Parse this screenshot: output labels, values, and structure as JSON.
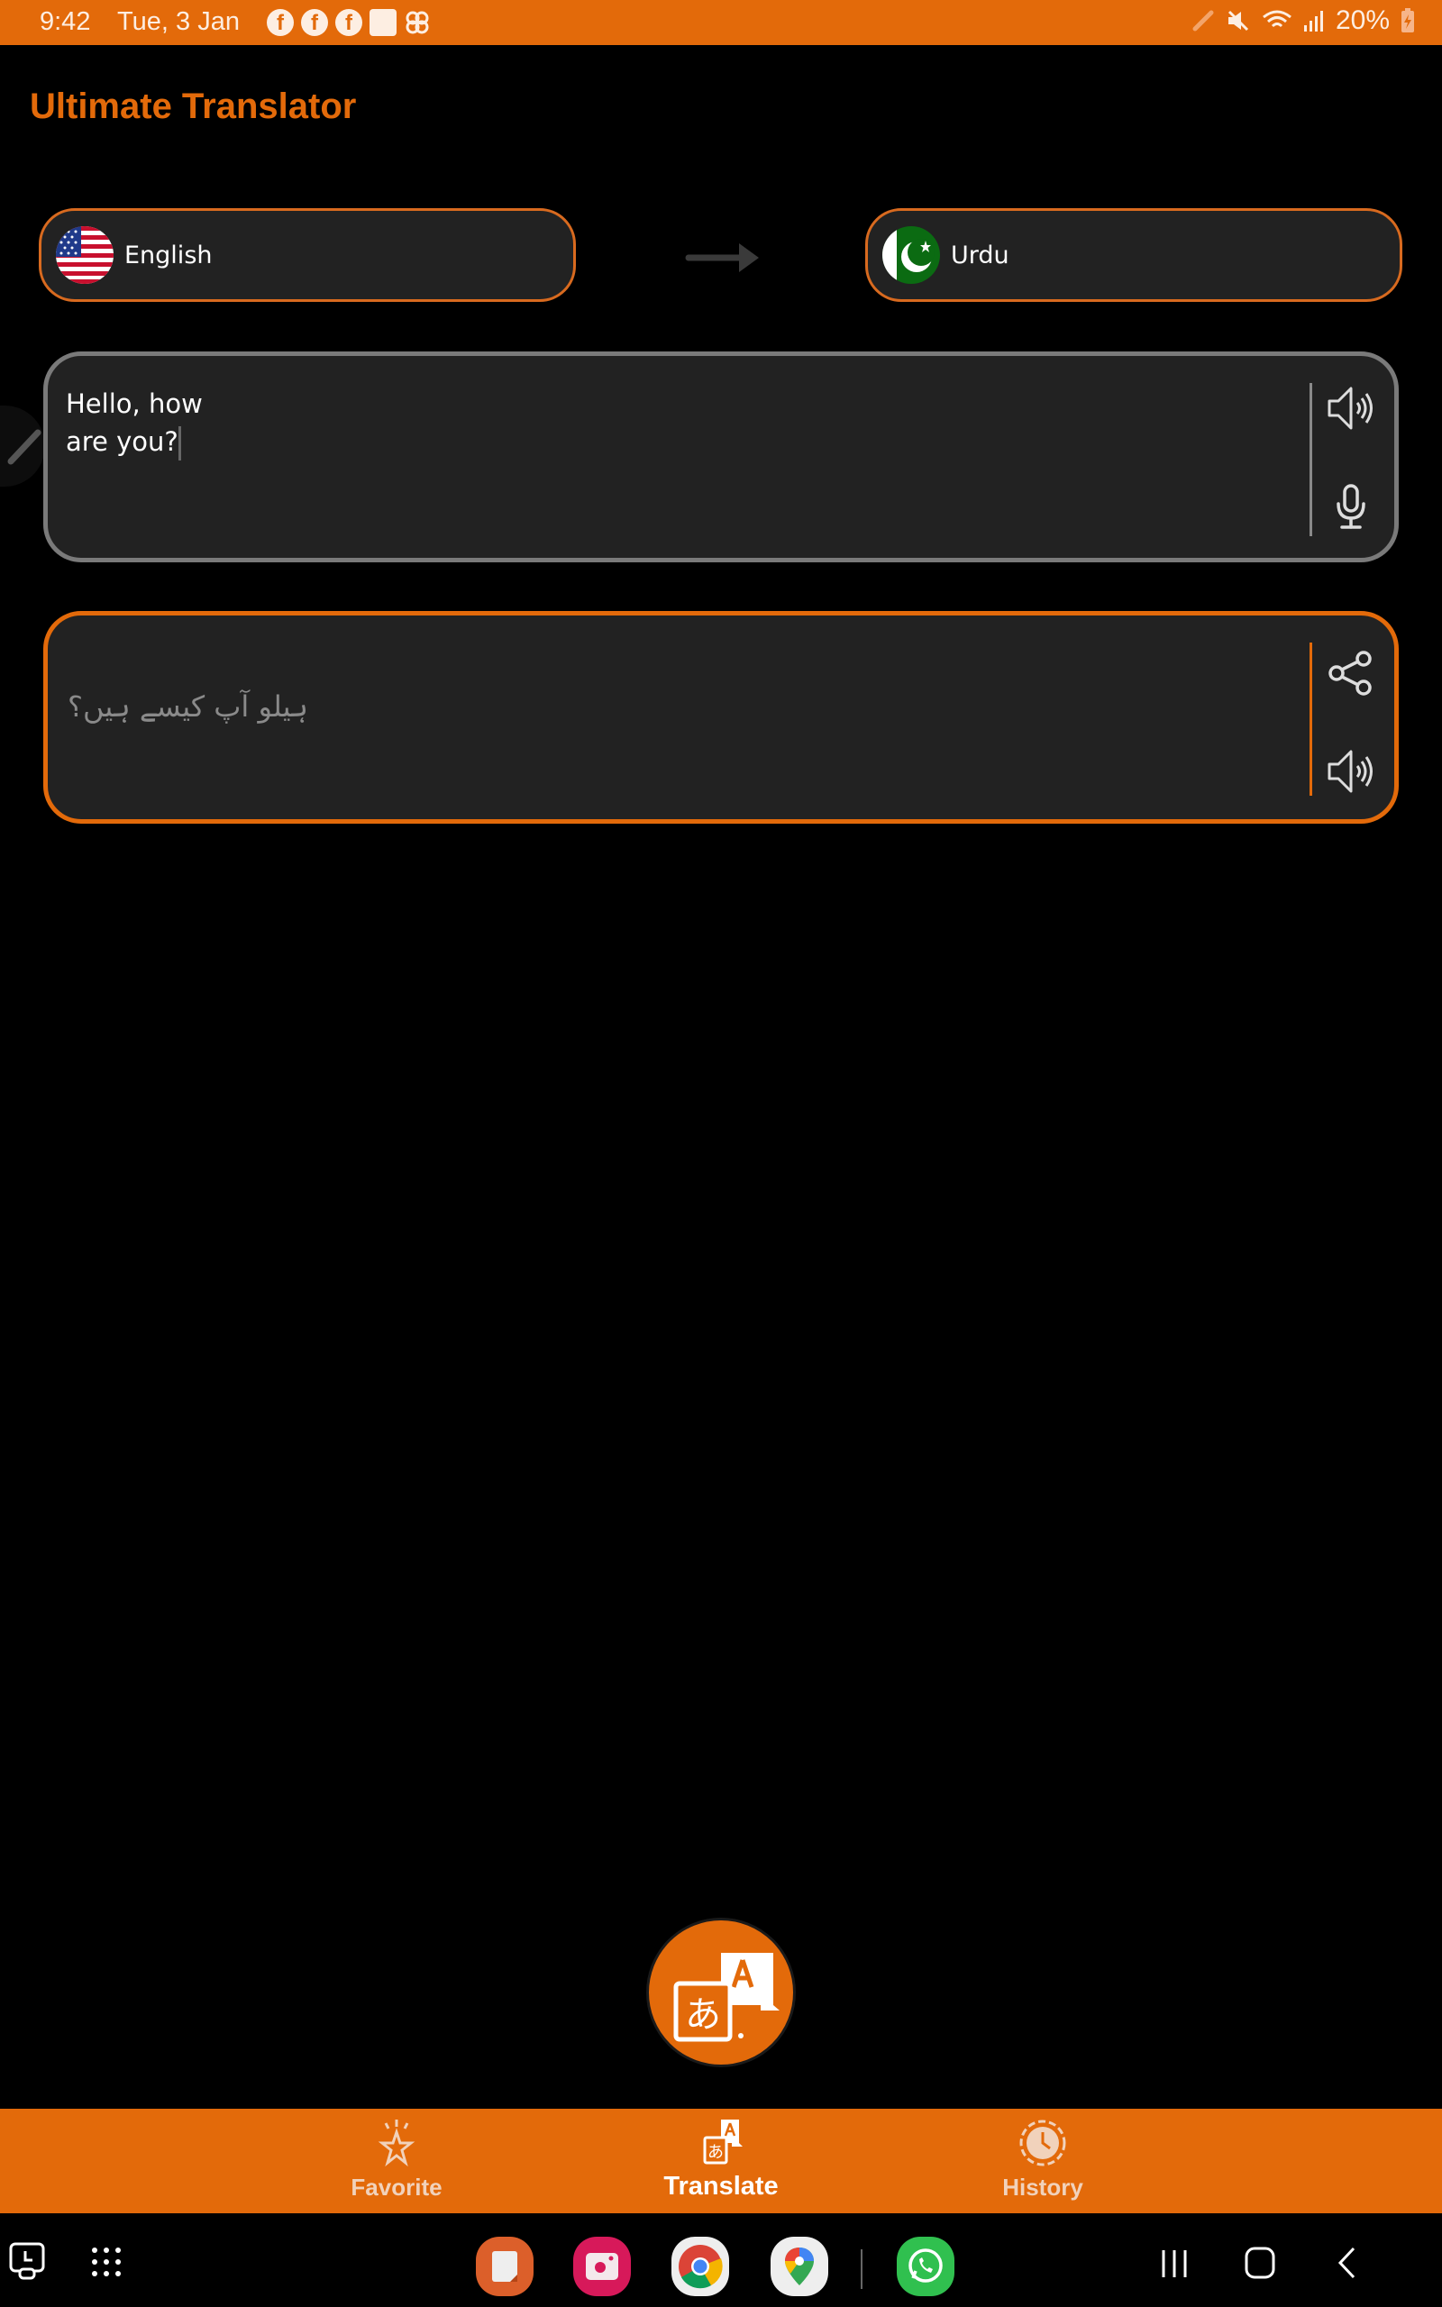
{
  "status_bar": {
    "time": "9:42",
    "date": "Tue, 3 Jan",
    "notification_icons": [
      "facebook-icon",
      "facebook-icon",
      "facebook-icon",
      "gallery-icon",
      "pinwheel-icon"
    ],
    "system_icons": [
      "pen-icon",
      "mute-icon",
      "wifi-icon",
      "signal-icon"
    ],
    "battery": "20%"
  },
  "app": {
    "title": "Ultimate Translator",
    "accent_color": "#E36A0A"
  },
  "languages": {
    "source": {
      "label": "English",
      "flag": "us-flag"
    },
    "target": {
      "label": "Urdu",
      "flag": "pakistan-flag"
    }
  },
  "input": {
    "text_line1": "Hello, how",
    "text_line2": "are you?"
  },
  "output": {
    "text": "ہیلو آپ کیسے ہیں؟"
  },
  "bottom_nav": {
    "items": [
      {
        "label": "Favorite",
        "icon": "star-icon",
        "active": false
      },
      {
        "label": "Translate",
        "icon": "translate-icon",
        "active": true
      },
      {
        "label": "History",
        "icon": "history-icon",
        "active": false
      }
    ]
  },
  "system_nav": {
    "dock_apps": [
      "Samsung Notes",
      "Camera",
      "Chrome",
      "Maps",
      "WhatsApp"
    ]
  }
}
